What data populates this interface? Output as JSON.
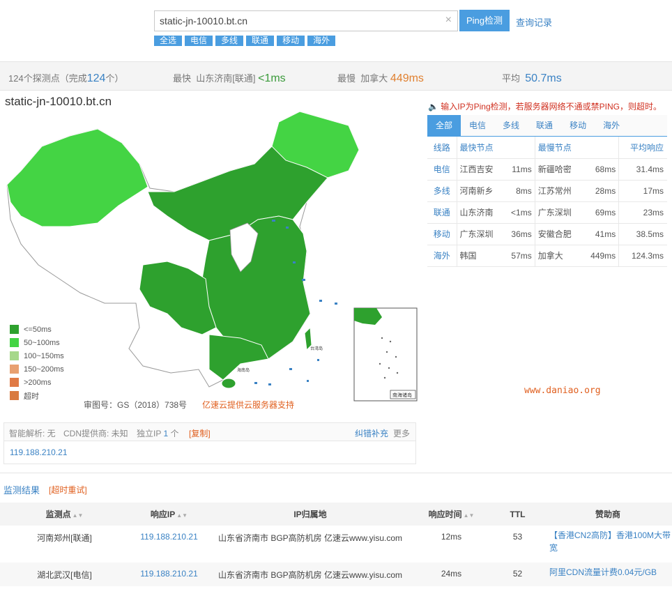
{
  "search": {
    "value": "static-jn-10010.bt.cn",
    "button": "Ping检测",
    "history": "查询记录"
  },
  "isp_tags": [
    "全选",
    "电信",
    "多线",
    "联通",
    "移动",
    "海外"
  ],
  "stats": {
    "probes_prefix": "124个探测点（完成",
    "probes_done": "124",
    "probes_suffix": "个）",
    "fastest_label": "最快",
    "fastest_node": "山东济南[联通]",
    "fastest_value": "<1ms",
    "slowest_label": "最慢",
    "slowest_node": "加拿大",
    "slowest_value": "449ms",
    "avg_label": "平均",
    "avg_value": "50.7ms"
  },
  "map": {
    "title": "static-jn-10010.bt.cn",
    "legend": [
      {
        "label": "<=50ms",
        "color": "#2ea12e"
      },
      {
        "label": "50~100ms",
        "color": "#44d444"
      },
      {
        "label": "100~150ms",
        "color": "#a6d88a"
      },
      {
        "label": "150~200ms",
        "color": "#e8a070"
      },
      {
        "label": ">200ms",
        "color": "#e07a45"
      },
      {
        "label": "超时",
        "color": "#d97a40"
      }
    ],
    "review_number": "审图号：GS（2018）738号",
    "sponsor": "亿速云提供云服务器支持",
    "inset_label": "南海诸岛",
    "hainan_label": "海南岛",
    "taiwan_label": "台湾岛"
  },
  "notice": "输入IP为Ping检测，若服务器网络不通或禁PING，则超时。",
  "tabs": [
    "全部",
    "电信",
    "多线",
    "联通",
    "移动",
    "海外"
  ],
  "summary": {
    "headers": [
      "线路",
      "最快节点",
      "最慢节点",
      "平均响应"
    ],
    "rows": [
      {
        "line": "电信",
        "fast": "江西吉安",
        "fast_ms": "11ms",
        "slow": "新疆哈密",
        "slow_ms": "68ms",
        "avg": "31.4ms"
      },
      {
        "line": "多线",
        "fast": "河南新乡",
        "fast_ms": "8ms",
        "slow": "江苏常州",
        "slow_ms": "28ms",
        "avg": "17ms"
      },
      {
        "line": "联通",
        "fast": "山东济南",
        "fast_ms": "<1ms",
        "slow": "广东深圳",
        "slow_ms": "69ms",
        "avg": "23ms"
      },
      {
        "line": "移动",
        "fast": "广东深圳",
        "fast_ms": "36ms",
        "slow": "安徽合肥",
        "slow_ms": "41ms",
        "avg": "38.5ms"
      },
      {
        "line": "海外",
        "fast": "韩国",
        "fast_ms": "57ms",
        "slow": "加拿大",
        "slow_ms": "449ms",
        "avg": "124.3ms"
      }
    ]
  },
  "watermark": "www.daniao.org",
  "info": {
    "dns": "智能解析: 无",
    "cdn": "CDN提供商: 未知",
    "ip_label": "独立IP",
    "ip_count": "1",
    "ip_unit": "个",
    "copy": "[复制]",
    "report": "纠错补充",
    "more": "更多",
    "ip": "119.188.210.21"
  },
  "results": {
    "title": "监测结果",
    "retry": "[超时重试]",
    "headers": [
      "监测点",
      "响应IP",
      "IP归属地",
      "响应时间",
      "TTL",
      "赞助商"
    ],
    "rows": [
      {
        "node": "河南郑州[联通]",
        "ip": "119.188.210.21",
        "loc": "山东省济南市 BGP高防机房 亿速云www.yisu.com",
        "time": "12ms",
        "ttl": "53",
        "sponsor": "【香港CN2高防】香港100M大带宽"
      },
      {
        "node": "湖北武汉[电信]",
        "ip": "119.188.210.21",
        "loc": "山东省济南市 BGP高防机房 亿速云www.yisu.com",
        "time": "24ms",
        "ttl": "52",
        "sponsor": "阿里CDN流量计费0.04元/GB"
      }
    ]
  }
}
